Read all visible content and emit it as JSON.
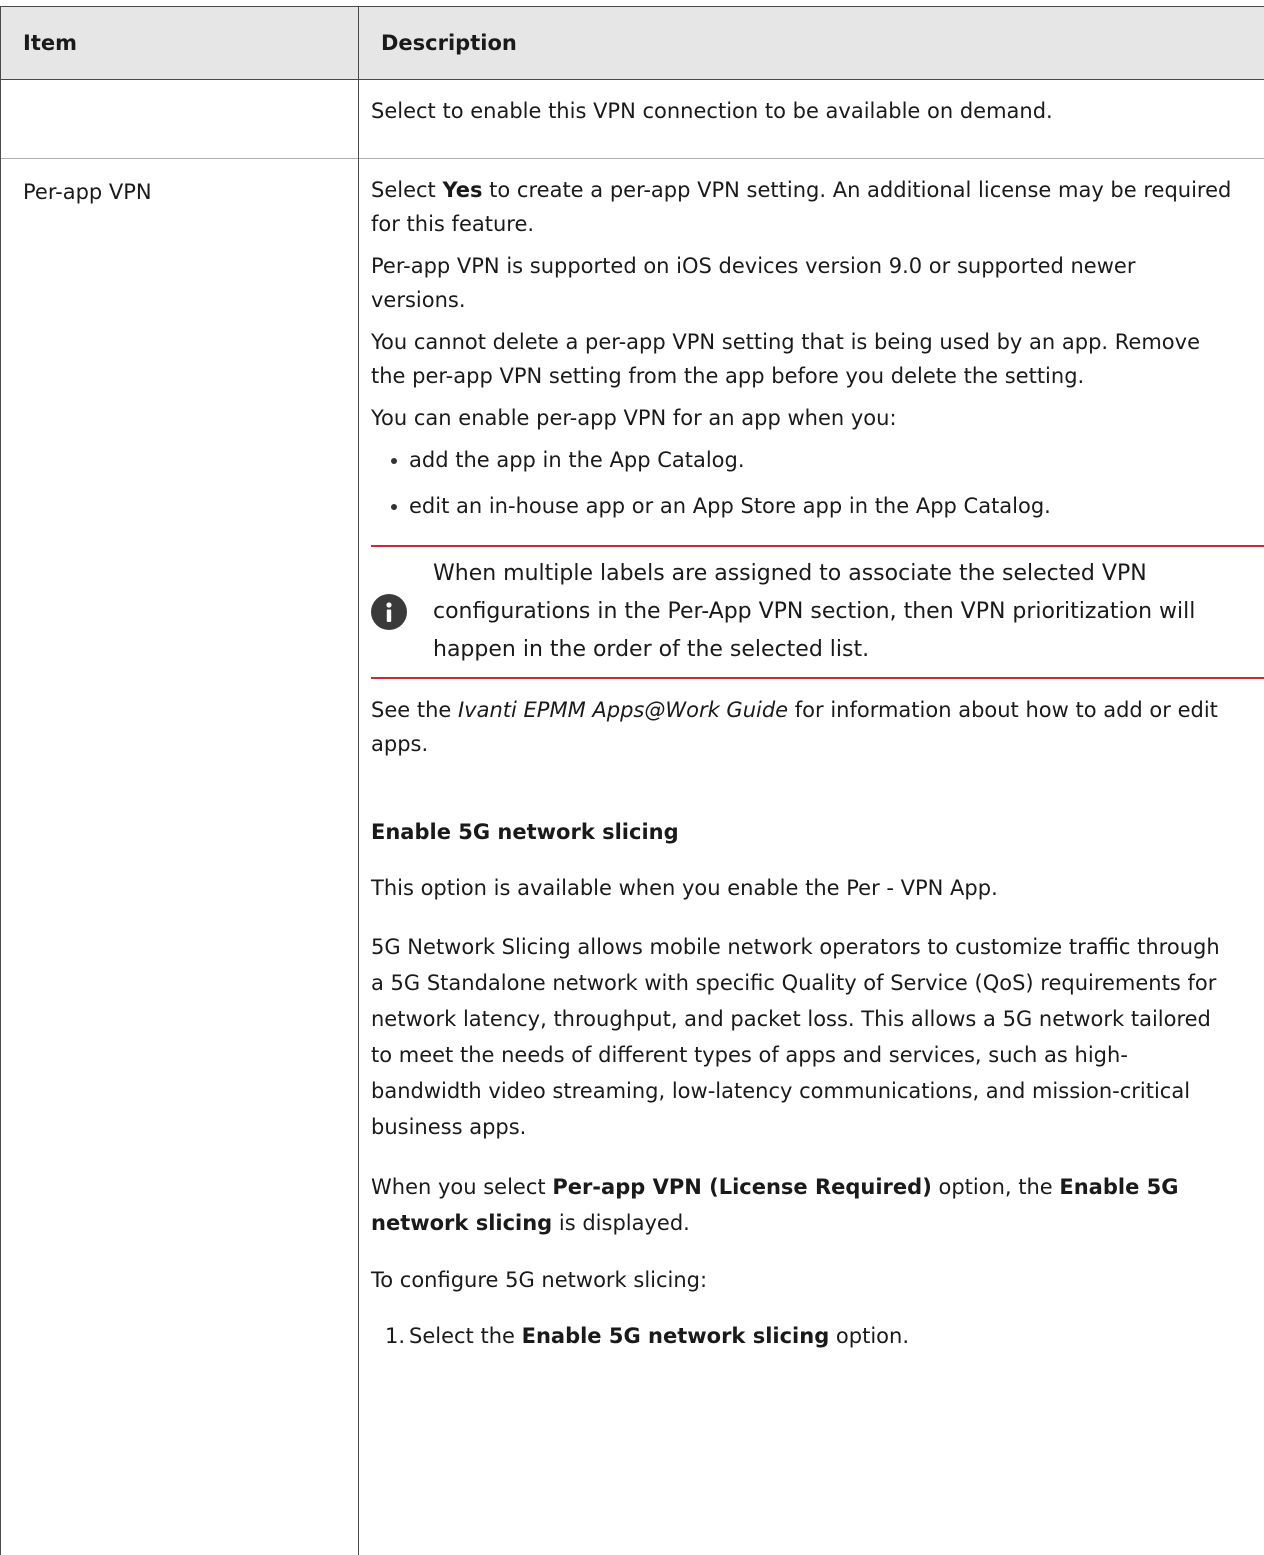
{
  "table": {
    "headers": {
      "item": "Item",
      "description": "Description"
    },
    "row1": {
      "item": "",
      "description": "Select to enable this VPN connection to be available on demand."
    },
    "row2": {
      "item": "Per-app VPN",
      "p1_pre": "Select ",
      "p1_bold": "Yes",
      "p1_post": " to create a per-app VPN setting. An additional license may be required for this feature.",
      "p2": "Per-app VPN is supported on iOS devices version 9.0 or supported newer versions.",
      "p3": "You cannot delete a per-app VPN setting that is being used by an app. Remove the per-app VPN setting from the app before you delete the setting.",
      "p4": "You can enable per-app VPN for an app when you:",
      "bullets": [
        "add the app in the App Catalog.",
        "edit an in-house app or an App Store app in the App Catalog."
      ],
      "note": {
        "icon": "info-icon",
        "text": "When multiple labels are assigned to associate the selected VPN configurations in the Per-App VPN section, then VPN prioritization will happen in the order of the selected list."
      },
      "see_pre": "See the ",
      "see_italic": "Ivanti EPMM Apps@Work Guide",
      "see_post": " for information about how to add or edit apps.",
      "heading_5g": "Enable 5G network slicing",
      "available": "This option is available when you enable the Per - VPN App.",
      "slicing_desc": "5G Network Slicing allows mobile network operators to customize traffic through a 5G Standalone network with specific Quality of Service (QoS) requirements for network latency, throughput, and packet loss. This allows a 5G network tailored to meet the needs of different types of apps and services, such as high-bandwidth video streaming, low-latency communications, and mission-critical business apps.",
      "when_pre": "When you select ",
      "when_bold1": "Per-app VPN (License Required)",
      "when_mid": " option, the ",
      "when_bold2": "Enable 5G network slicing",
      "when_post": " is displayed.",
      "configure": "To configure 5G network slicing:",
      "step1_num": "1.",
      "step1_pre": "Select the ",
      "step1_bold": "Enable 5G network slicing",
      "step1_post": " option."
    }
  }
}
